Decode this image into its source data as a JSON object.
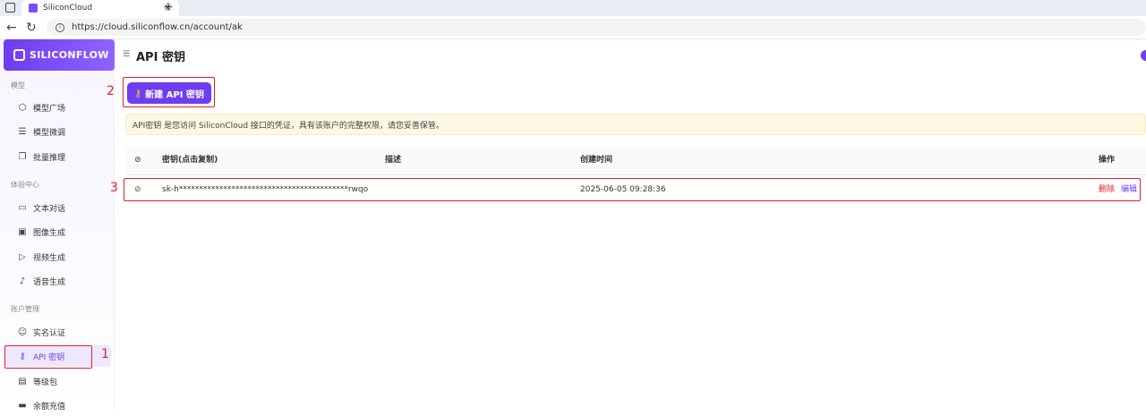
{
  "browser": {
    "tab_title": "SiliconCloud",
    "tab_close": "✕",
    "new_tab": "+",
    "url": "https://cloud.siliconflow.cn/account/ak"
  },
  "sidebar": {
    "logo_text": "SILICONFLOW",
    "sections": [
      {
        "title": "模型",
        "items": [
          {
            "label": "模型广场",
            "icon": "cube-icon"
          },
          {
            "label": "模型微调",
            "icon": "sliders-icon"
          },
          {
            "label": "批量推理",
            "icon": "layers-icon"
          }
        ]
      },
      {
        "title": "体验中心",
        "items": [
          {
            "label": "文本对话",
            "icon": "chat-icon"
          },
          {
            "label": "图像生成",
            "icon": "image-icon"
          },
          {
            "label": "视频生成",
            "icon": "video-icon"
          },
          {
            "label": "语音生成",
            "icon": "mic-icon"
          }
        ]
      },
      {
        "title": "账户管理",
        "items": [
          {
            "label": "实名认证",
            "icon": "user-check-icon"
          },
          {
            "label": "API 密钥",
            "icon": "key-icon"
          },
          {
            "label": "等级包",
            "icon": "wallet-icon"
          },
          {
            "label": "余额充值",
            "icon": "card-icon"
          }
        ]
      }
    ]
  },
  "annotations": {
    "a1": "1",
    "a2": "2",
    "a3": "3"
  },
  "header": {
    "title": "API 密钥"
  },
  "actions": {
    "new_key_label": "新建 API 密钥"
  },
  "notice": {
    "text": "API密钥 是您访问 SiliconCloud 接口的凭证，具有该账户的完整权限，请您妥善保管。"
  },
  "table": {
    "columns": [
      "密钥(点击复制)",
      "描述",
      "创建时间",
      "操作"
    ],
    "rows": [
      {
        "key": "sk-h******************************************rwqo",
        "description": "",
        "created": "2025-06-05 09:28:36",
        "delete_label": "删除",
        "edit_label": "编辑"
      }
    ]
  },
  "colors": {
    "accent": "#6f3ef0",
    "danger": "#e0202a",
    "notice_bg": "#fdf8e3"
  }
}
